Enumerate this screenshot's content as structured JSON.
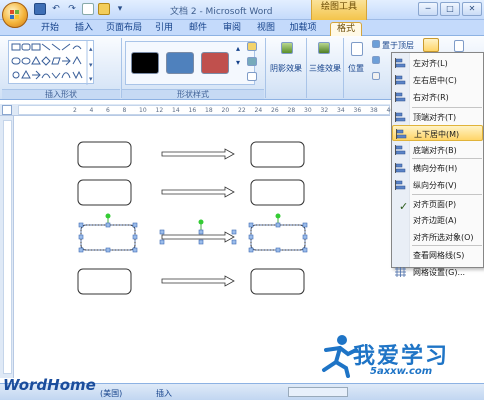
{
  "window": {
    "title": "文档 2 - Microsoft Word",
    "context_tool": "绘图工具"
  },
  "tabs": [
    {
      "label": "开始"
    },
    {
      "label": "插入"
    },
    {
      "label": "页面布局"
    },
    {
      "label": "引用"
    },
    {
      "label": "邮件"
    },
    {
      "label": "审阅"
    },
    {
      "label": "视图"
    },
    {
      "label": "加载项"
    },
    {
      "label": "格式"
    }
  ],
  "ribbon": {
    "insert_shapes_label": "插入形状",
    "shape_styles_label": "形状样式",
    "shadow_effect": "阴影效果",
    "three_d_effect": "三维效果",
    "position": "位置",
    "bring_to_front": "置于顶层",
    "swatch_colors": [
      "#000000",
      "#4f81bd",
      "#c0504d"
    ]
  },
  "menu": {
    "items": [
      {
        "label": "左对齐(L)",
        "icon": "align-left-icon"
      },
      {
        "label": "左右居中(C)",
        "icon": "align-center-icon"
      },
      {
        "label": "右对齐(R)",
        "icon": "align-right-icon"
      },
      {
        "label": "顶端对齐(T)",
        "icon": "align-top-icon"
      },
      {
        "label": "上下居中(M)",
        "icon": "align-middle-icon"
      },
      {
        "label": "底端对齐(B)",
        "icon": "align-bottom-icon"
      },
      {
        "label": "横向分布(H)",
        "icon": "distribute-horizontal-icon"
      },
      {
        "label": "纵向分布(V)",
        "icon": "distribute-vertical-icon"
      },
      {
        "label": "对齐页面(P)",
        "icon": "checkmark-icon"
      },
      {
        "label": "对齐边距(A)",
        "icon": ""
      },
      {
        "label": "对齐所选对象(O)",
        "icon": ""
      },
      {
        "label": "查看网格线(S)",
        "icon": ""
      },
      {
        "label": "网格设置(G)...",
        "icon": "grid-icon"
      }
    ],
    "highlighted_index": 4
  },
  "ruler": {
    "numbers": [
      "2",
      "4",
      "6",
      "8",
      "10",
      "12",
      "14",
      "16",
      "18",
      "20",
      "22",
      "24",
      "26",
      "28",
      "30",
      "32",
      "34",
      "36",
      "38",
      "40"
    ]
  },
  "status": {
    "language": "(美国)",
    "mode": "插入"
  },
  "watermark": {
    "brand": "WordHome",
    "site_text": "我爱学习",
    "site_url": "5axxw.com"
  }
}
